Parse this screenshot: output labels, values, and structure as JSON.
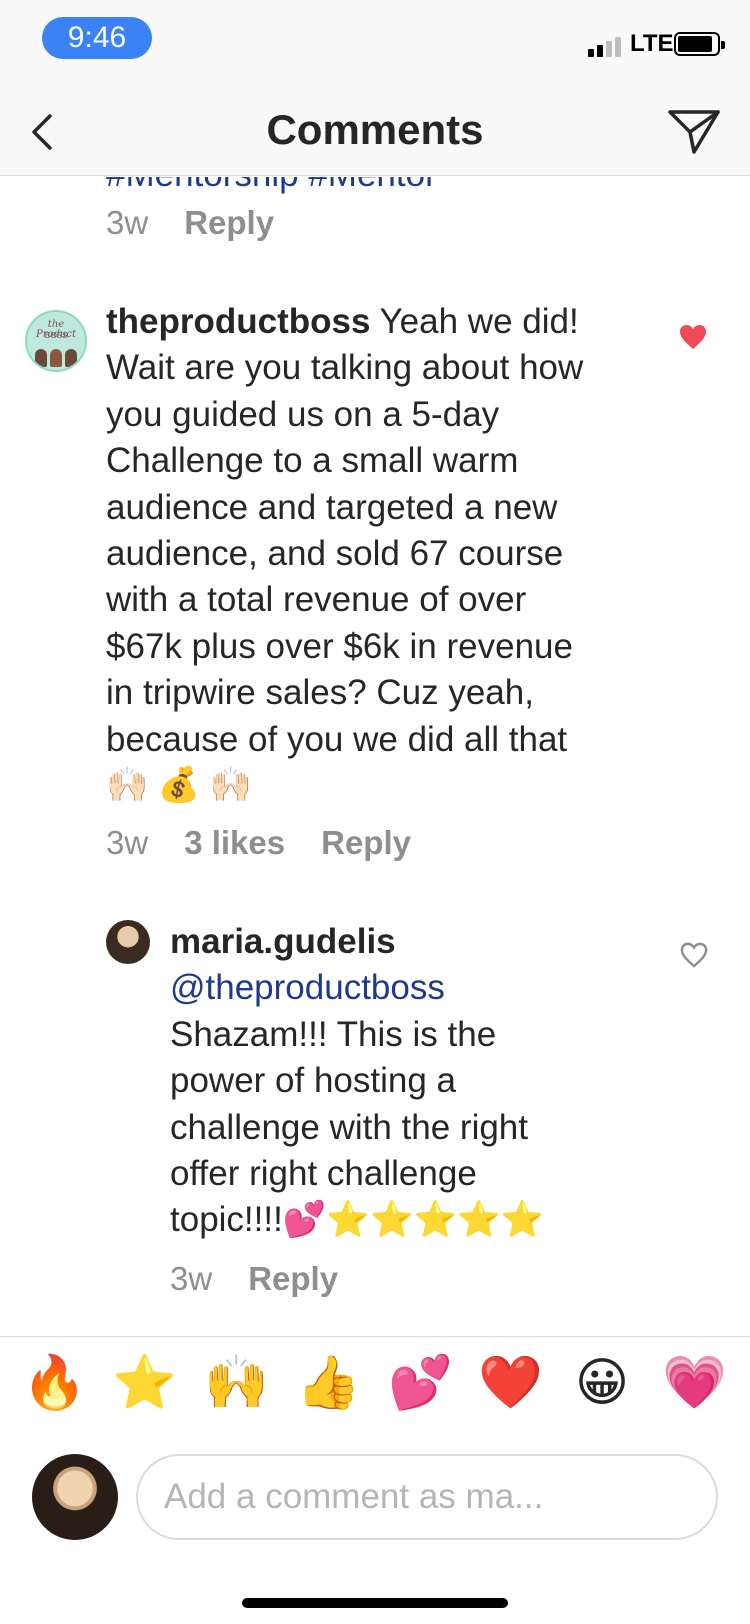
{
  "status_bar": {
    "time": "9:46",
    "network": "LTE"
  },
  "header": {
    "title": "Comments",
    "back_icon": "chevron-left-icon",
    "send_icon": "paper-plane-icon"
  },
  "thread": {
    "partial_top_text": "#Mentorship #Mentor",
    "partial_meta": {
      "time": "3w",
      "reply": "Reply"
    },
    "comments": [
      {
        "username": "theproductboss",
        "avatar_text_1": "the Product",
        "avatar_text_2": "BOSS",
        "lines": [
          "Yeah we did!",
          "Wait are you talking about how",
          "you guided us on a 5-day",
          "Challenge to a small warm",
          "audience and targeted a new",
          "audience, and sold 67 course",
          "with a total revenue of over",
          "$67k plus over $6k in revenue",
          "in tripwire sales? Cuz yeah,",
          "because of you we did all that"
        ],
        "emojis": "🙌🏻 💰 🙌🏻",
        "time": "3w",
        "likes": "3 likes",
        "reply": "Reply",
        "liked": true,
        "heart_color": "#ed4956"
      },
      {
        "username": "maria.gudelis",
        "mention": "@theproductboss",
        "lines": [
          "Shazam!!! This is the",
          "power of hosting a",
          "challenge with the right",
          "offer right challenge",
          "topic!!!!💕⭐⭐⭐⭐⭐"
        ],
        "time": "3w",
        "reply": "Reply",
        "liked": false
      }
    ]
  },
  "emoji_bar": [
    "🔥",
    "⭐",
    "🙌",
    "👍",
    "💕",
    "❤️",
    "😀",
    "💗"
  ],
  "composer": {
    "placeholder": "Add a comment as ma..."
  },
  "colors": {
    "link": "#1e3a8a",
    "meta": "#8e8e8e",
    "time_pill": "#3b82f6"
  }
}
